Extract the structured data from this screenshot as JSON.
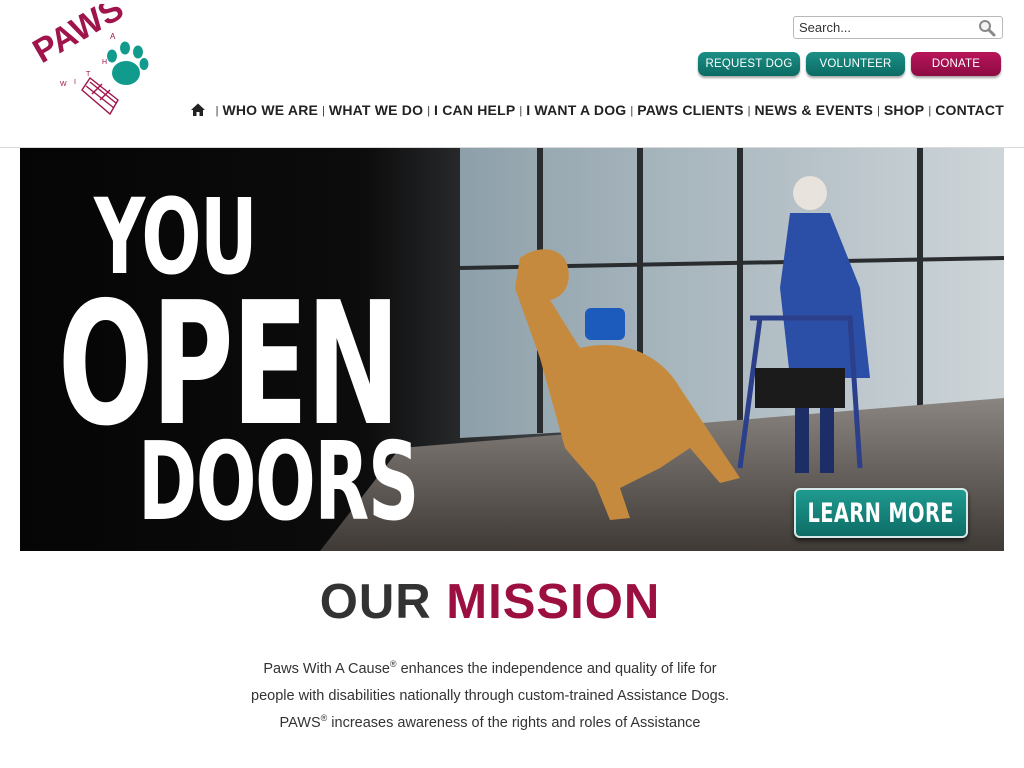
{
  "brand": {
    "logo_text": "PAWS",
    "logo_sub": "WITH A CAUSE",
    "primary_color": "#9b1040",
    "accent_color": "#0b6b63"
  },
  "search": {
    "placeholder": "Search...",
    "icon": "search-icon"
  },
  "cta_buttons": [
    {
      "label": "REQUEST DOG",
      "color": "#0b6b63"
    },
    {
      "label": "VOLUNTEER",
      "color": "#0b6b63"
    },
    {
      "label": "DONATE",
      "color": "#8c0b43"
    }
  ],
  "nav": {
    "home_icon": "home-icon",
    "items": [
      {
        "label": "WHO WE ARE"
      },
      {
        "label": "WHAT WE DO"
      },
      {
        "label": "I CAN HELP"
      },
      {
        "label": "I WANT A DOG"
      },
      {
        "label": "PAWS CLIENTS"
      },
      {
        "label": "NEWS & EVENTS"
      },
      {
        "label": "SHOP"
      },
      {
        "label": "CONTACT"
      }
    ],
    "separator": "|"
  },
  "hero": {
    "line1": "YOU",
    "line2": "OPEN",
    "line3": "DOORS",
    "button_label": "LEARN MORE"
  },
  "mission": {
    "title_part1": "OUR",
    "title_part2": "MISSION",
    "p1_org": "Paws With A Cause",
    "p1_reg": "®",
    "p1_text": " enhances the independence and quality of life for people with disabilities nationally through custom-trained Assistance Dogs.",
    "p2_org": "PAWS",
    "p2_reg": "®",
    "p2_text": " increases awareness of the rights and roles of Assistance"
  }
}
